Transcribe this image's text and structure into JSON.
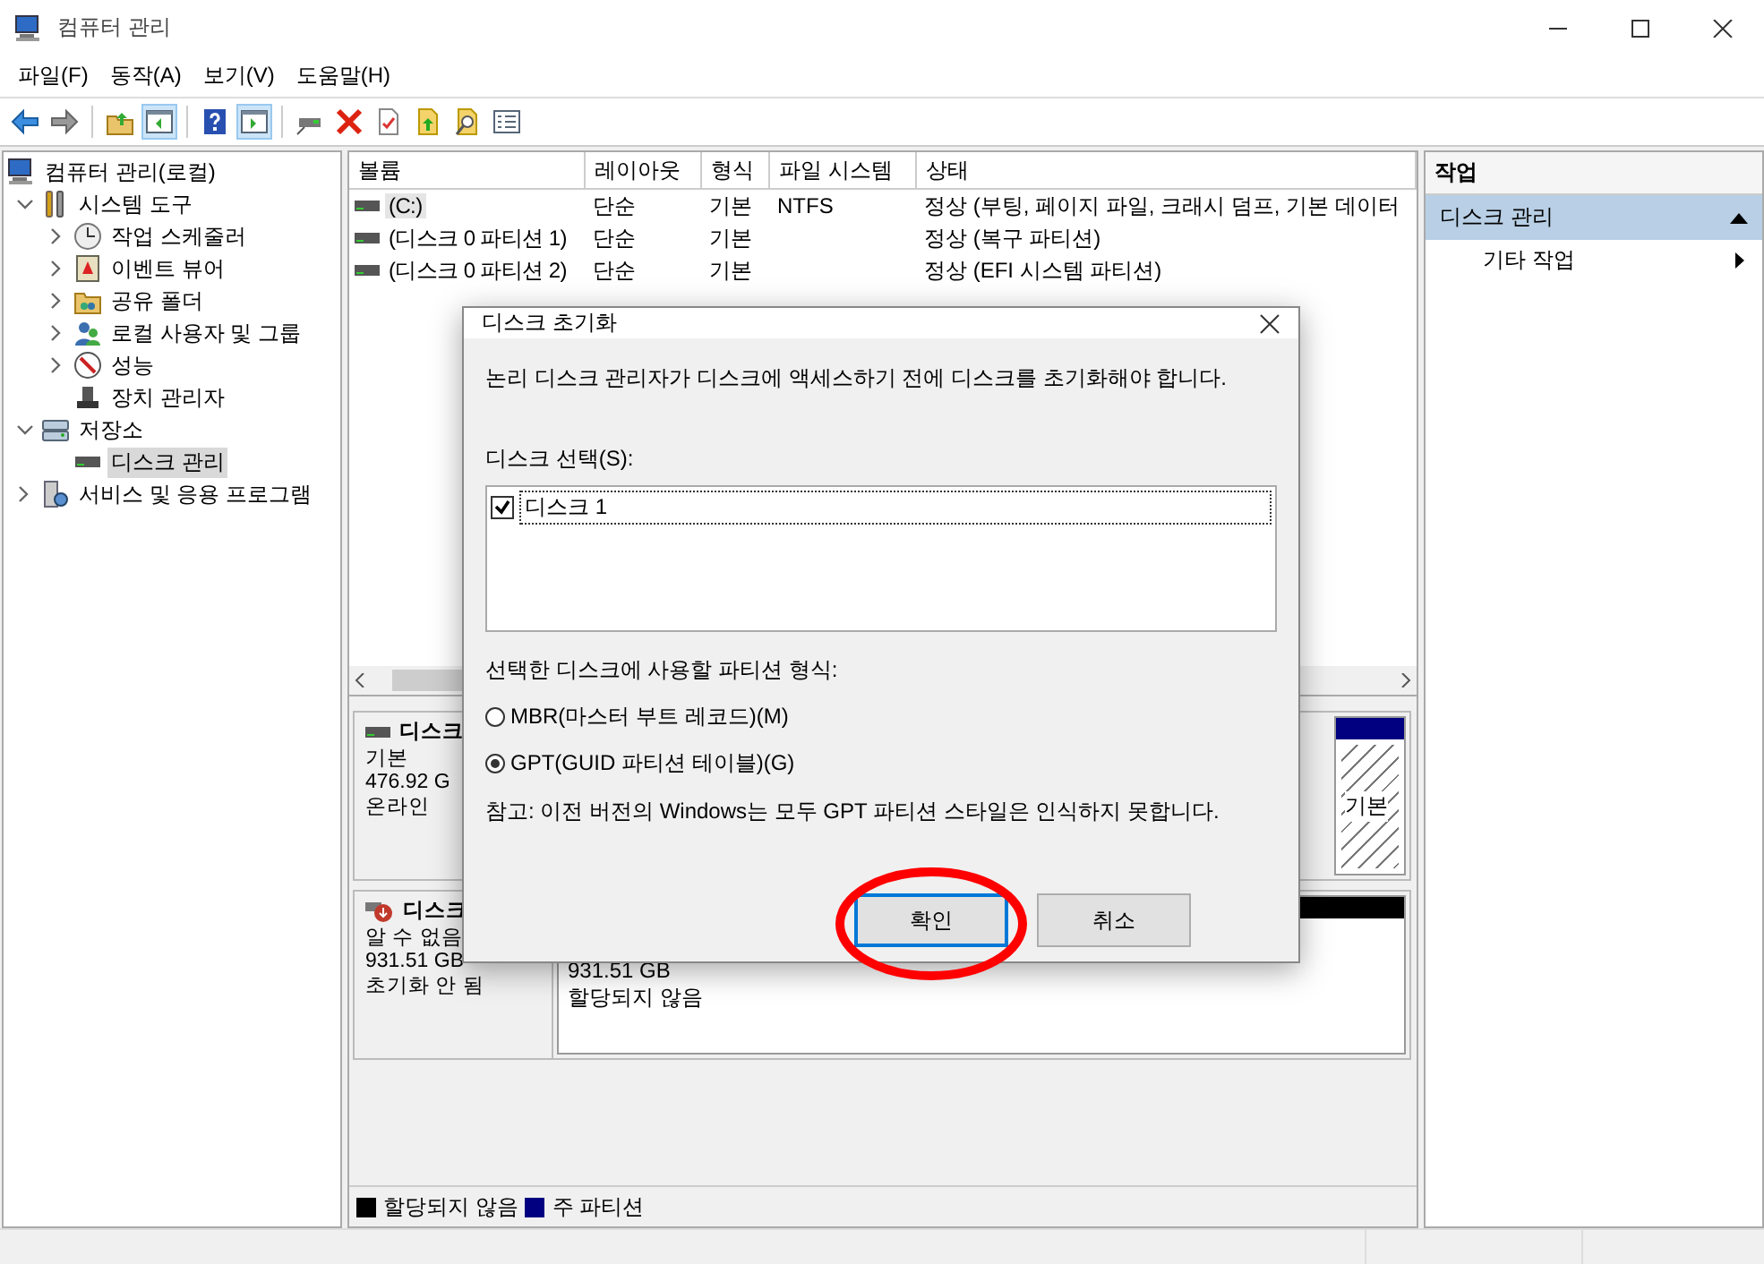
{
  "window": {
    "title": "컴퓨터 관리"
  },
  "menu": [
    "파일(F)",
    "동작(A)",
    "보기(V)",
    "도움말(H)"
  ],
  "toolbar": [
    {
      "kind": "back",
      "pressed": false
    },
    {
      "kind": "forward",
      "pressed": false
    },
    {
      "kind": "sep"
    },
    {
      "kind": "up",
      "pressed": false
    },
    {
      "kind": "tree",
      "pressed": true
    },
    {
      "kind": "sep"
    },
    {
      "kind": "help",
      "pressed": false
    },
    {
      "kind": "pane",
      "pressed": true
    },
    {
      "kind": "sep"
    },
    {
      "kind": "connect",
      "pressed": false
    },
    {
      "kind": "delete",
      "pressed": false
    },
    {
      "kind": "props",
      "pressed": false
    },
    {
      "kind": "export",
      "pressed": false
    },
    {
      "kind": "find",
      "pressed": false
    },
    {
      "kind": "list",
      "pressed": false
    }
  ],
  "tree": [
    {
      "label": "컴퓨터 관리(로컬)",
      "kind": "computer",
      "selected": false,
      "children": [
        {
          "label": "시스템 도구",
          "kind": "tools",
          "selected": false,
          "expanded": true,
          "children": [
            {
              "label": "작업 스케줄러",
              "kind": "clock",
              "selected": false,
              "expanded": false
            },
            {
              "label": "이벤트 뷰어",
              "kind": "event",
              "selected": false,
              "expanded": false
            },
            {
              "label": "공유 폴더",
              "kind": "share",
              "selected": false,
              "expanded": false
            },
            {
              "label": "로컬 사용자 및 그룹",
              "kind": "users",
              "selected": false,
              "expanded": false
            },
            {
              "label": "성능",
              "kind": "perf",
              "selected": false,
              "expanded": false
            },
            {
              "label": "장치 관리자",
              "kind": "device",
              "selected": false
            }
          ]
        },
        {
          "label": "저장소",
          "kind": "storage",
          "selected": false,
          "expanded": true,
          "children": [
            {
              "label": "디스크 관리",
              "kind": "disk",
              "selected": true
            }
          ]
        },
        {
          "label": "서비스 및 응용 프로그램",
          "kind": "services",
          "selected": false,
          "expanded": false
        }
      ]
    }
  ],
  "volumes": {
    "columns": [
      "볼륨",
      "레이아웃",
      "형식",
      "파일 시스템",
      "상태"
    ],
    "rows": [
      {
        "cells": [
          "(C:)",
          "단순",
          "기본",
          "NTFS",
          "정상 (부팅, 페이지 파일, 크래시 덤프, 기본 데이터"
        ],
        "selected": true
      },
      {
        "cells": [
          "(디스크 0 파티션 1)",
          "단순",
          "기본",
          "",
          "정상 (복구 파티션)"
        ],
        "selected": false
      },
      {
        "cells": [
          "(디스크 0 파티션 2)",
          "단순",
          "기본",
          "",
          "정상 (EFI 시스템 파티션)"
        ],
        "selected": false
      }
    ]
  },
  "disks": [
    {
      "label": "디스크",
      "kind": "online",
      "lines": [
        "기본",
        "476.92 G",
        "온라인"
      ],
      "partitions": [
        {
          "kind": "primary",
          "color": "#000080",
          "selected": true,
          "lines": [
            "기본"
          ]
        }
      ]
    },
    {
      "label": "디스크",
      "kind": "unknown",
      "lines": [
        "알 수 없음",
        "931.51 GB",
        "초기화 안 됨"
      ],
      "partitions": [
        {
          "kind": "unallocated",
          "color": "#000000",
          "selected": false,
          "lines": [
            "931.51 GB",
            "할당되지 않음"
          ]
        }
      ]
    }
  ],
  "legend": [
    {
      "label": "할당되지 않음",
      "color": "#000000"
    },
    {
      "label": "주 파티션",
      "color": "#000080"
    }
  ],
  "actions": {
    "title": "작업",
    "sections": [
      {
        "label": "디스크 관리",
        "expanded": true,
        "items": [
          "기타 작업"
        ]
      }
    ]
  },
  "dialog": {
    "title": "디스크 초기화",
    "message": "논리 디스크 관리자가 디스크에 액세스하기 전에 디스크를 초기화해야 합니다.",
    "disk_label": "디스크 선택(S):",
    "disks": [
      {
        "label": "디스크 1",
        "checked": true,
        "selected": true
      }
    ],
    "style_label": "선택한 디스크에 사용할 파티션 형식:",
    "styles": [
      {
        "label": "MBR(마스터 부트 레코드)(M)",
        "selected": false
      },
      {
        "label": "GPT(GUID 파티션 테이블)(G)",
        "selected": true
      }
    ],
    "note": "참고: 이전 버전의 Windows는 모두 GPT 파티션 스타일은 인식하지 못합니다.",
    "buttons": [
      {
        "label": "확인",
        "default": true
      },
      {
        "label": "취소",
        "default": false
      }
    ]
  },
  "annotation": {
    "kind": "ellipse",
    "color": "#ff0000"
  }
}
